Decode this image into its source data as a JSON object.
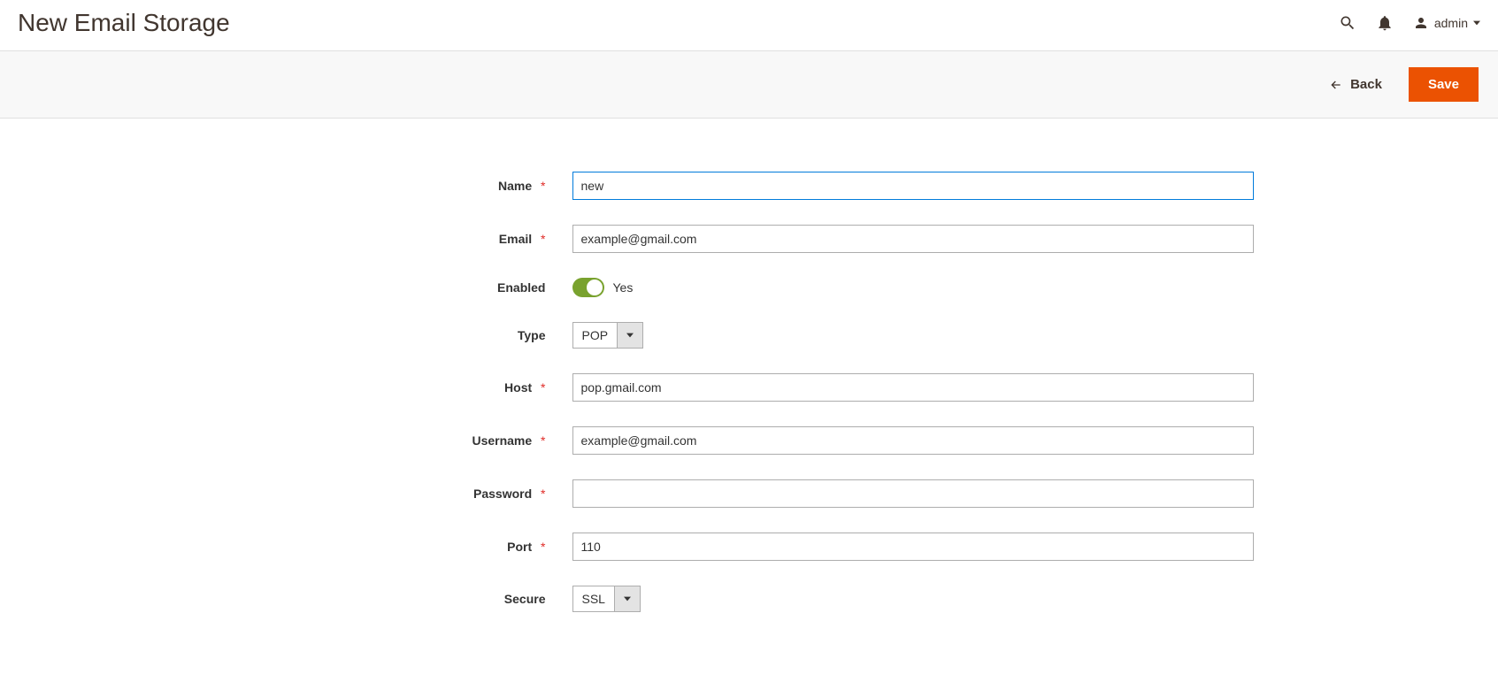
{
  "header": {
    "title": "New Email Storage",
    "user_label": "admin"
  },
  "actions": {
    "back_label": "Back",
    "save_label": "Save"
  },
  "form": {
    "name": {
      "label": "Name",
      "value": "new",
      "required": true
    },
    "email": {
      "label": "Email",
      "value": "example@gmail.com",
      "required": true
    },
    "enabled": {
      "label": "Enabled",
      "value_text": "Yes",
      "on": true
    },
    "type": {
      "label": "Type",
      "value": "POP"
    },
    "host": {
      "label": "Host",
      "value": "pop.gmail.com",
      "required": true
    },
    "username": {
      "label": "Username",
      "value": "example@gmail.com",
      "required": true
    },
    "password": {
      "label": "Password",
      "value": "",
      "required": true
    },
    "port": {
      "label": "Port",
      "value": "110",
      "required": true
    },
    "secure": {
      "label": "Secure",
      "value": "SSL"
    }
  },
  "required_asterisk": "*"
}
